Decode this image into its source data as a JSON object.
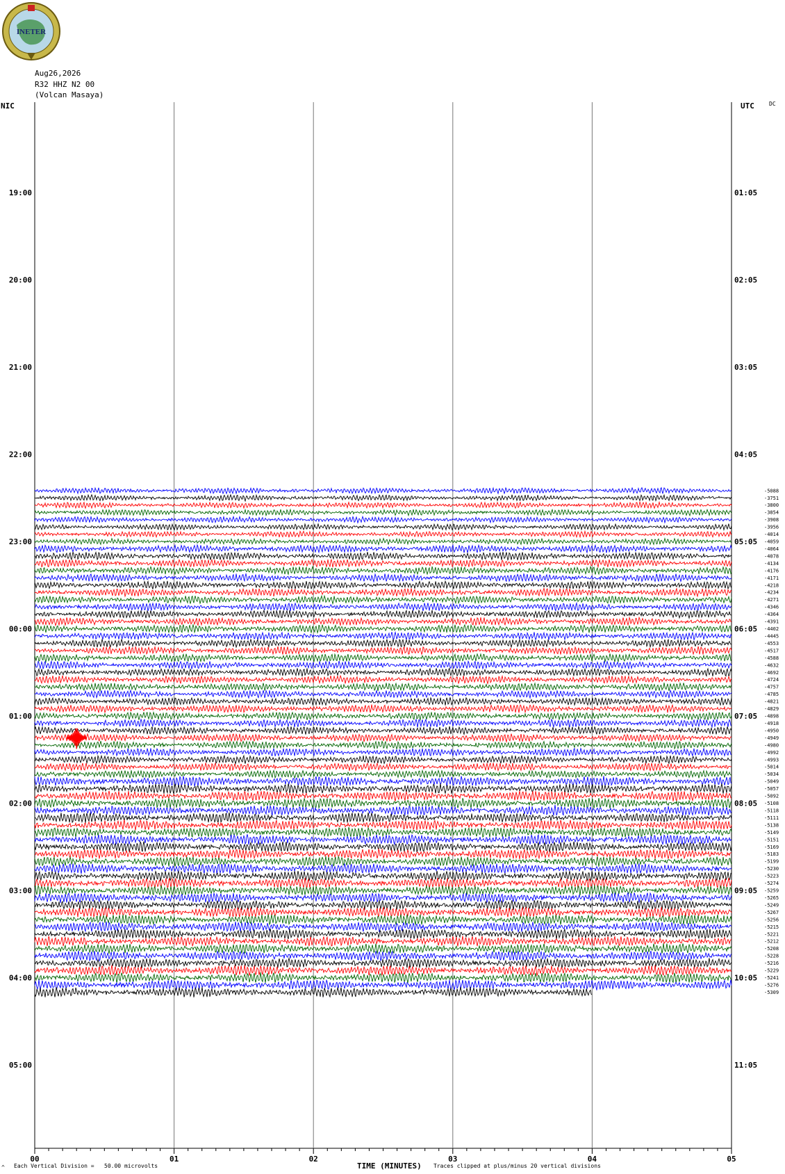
{
  "logo": {
    "text": "INETER",
    "colors": {
      "ring": "#c8b84a",
      "globe": "#5aa06a",
      "sea": "#b8d8e8",
      "flag_red": "#cc2222"
    }
  },
  "header": {
    "date": "Aug26,2026",
    "station": "R32 HHZ N2 00",
    "location": "(Volcan Masaya)"
  },
  "left_axis_label": "NIC",
  "right_axis_label": "UTC",
  "dc_label": "DC",
  "footer": {
    "division_note": "Each Vertical Division =   50.00 microvolts",
    "xlabel": "TIME (MINUTES)",
    "clip_note": "Traces clipped at plus/minus 20 vertical divisions",
    "mark": "^"
  },
  "chart_data": {
    "type": "line",
    "title": "",
    "xlabel": "TIME (MINUTES)",
    "x_ticks": [
      "00",
      "01",
      "02",
      "03",
      "04",
      "05"
    ],
    "xlim": [
      0,
      5
    ],
    "left_time_labels": [
      "19:00",
      "20:00",
      "21:00",
      "22:00",
      "23:00",
      "00:00",
      "01:00",
      "02:00",
      "03:00",
      "04:00",
      "05:00"
    ],
    "right_time_labels": [
      "01:05",
      "02:05",
      "03:05",
      "04:05",
      "05:05",
      "06:05",
      "07:05",
      "08:05",
      "09:05",
      "10:05",
      "11:05"
    ],
    "hour_span_first_label": "19:00",
    "trace_interval_minutes": 5,
    "first_trace_local": "22:25",
    "last_trace_local": "04:20",
    "trace_colors": [
      "#0000ff",
      "#000000",
      "#ff0000",
      "#006400"
    ],
    "dc_offsets": [
      -5088,
      -3751,
      -3800,
      -3854,
      -3908,
      -3956,
      -4014,
      -4059,
      -4064,
      -4078,
      -4134,
      -4176,
      -4171,
      -4218,
      -4234,
      -4271,
      -4346,
      -4364,
      -4391,
      -4402,
      -4445,
      -4553,
      -4517,
      -4588,
      -4632,
      -4692,
      -4724,
      -4757,
      -4785,
      -4821,
      -4829,
      -4898,
      -4918,
      -4950,
      -4949,
      -4980,
      -4992,
      -4993,
      -5014,
      -5034,
      -5049,
      -5057,
      -5092,
      -5108,
      -5118,
      -5111,
      -5138,
      -5149,
      -5151,
      -5169,
      -5183,
      -5199,
      -5230,
      -5223,
      -5274,
      -5259,
      -5265,
      -5249,
      -5267,
      -5256,
      -5215,
      -5221,
      -5212,
      -5208,
      -5228,
      -5216,
      -5229,
      -5241,
      -5276,
      -5309
    ],
    "event": {
      "trace_index": 34,
      "minute": 0.3,
      "color": "red"
    },
    "last_trace_end_minute": 4.0,
    "grid": true
  }
}
